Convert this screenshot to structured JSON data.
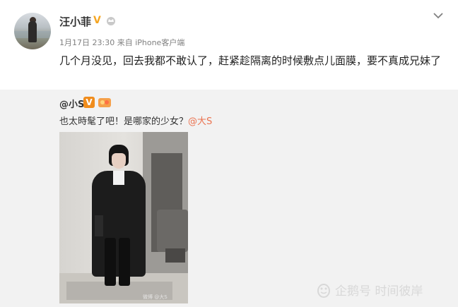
{
  "post": {
    "username": "汪小菲",
    "verified_badge": "V",
    "time": "1月17日 23:30",
    "source": "来自 iPhone客户端",
    "text": "几个月没见，回去我都不敢认了，赶紧趁隔离的时候敷点儿面膜，要不真成兄妹了"
  },
  "repost": {
    "username": "@小S",
    "verified_badge": "V",
    "text": "也太時髦了吧！是哪家的少女？",
    "mention": "@大S",
    "photo_watermark": "微博 @大S"
  },
  "watermark": {
    "text": "企鹅号 时间彼岸"
  },
  "icons": [
    "avatar",
    "gold-v-icon",
    "crown-icon",
    "chevron-down-icon",
    "orange-v-icon",
    "vip-badge-icon",
    "penguin-logo-icon"
  ],
  "colors": {
    "repost_bg": "#f2f2f2",
    "mention": "#eb7350",
    "verified": "#f5a623",
    "meta": "#808080"
  }
}
